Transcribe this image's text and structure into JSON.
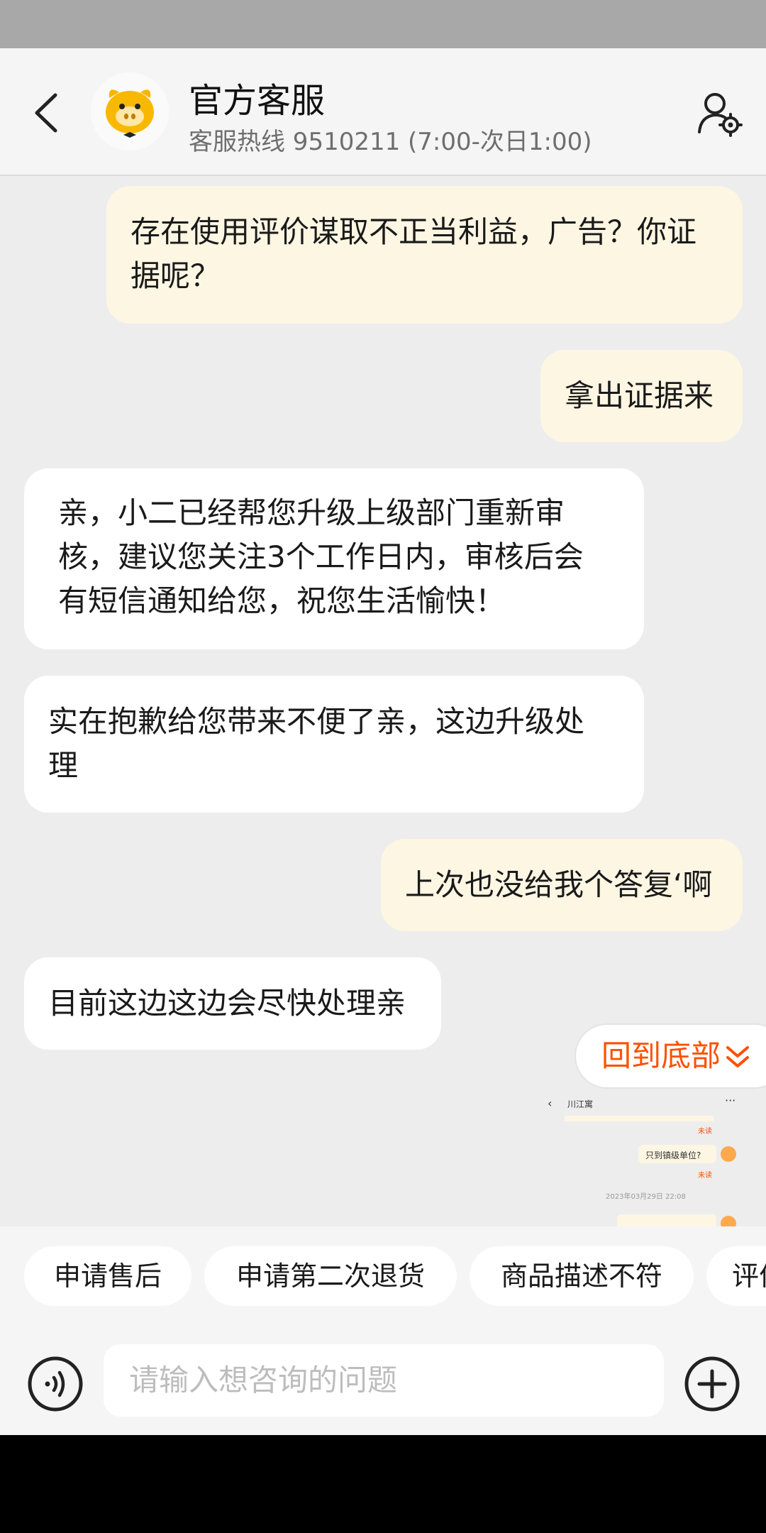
{
  "header": {
    "title": "官方客服",
    "subtitle": "客服热线 9510211 (7:00-次日1:00)"
  },
  "messages": [
    {
      "side": "out",
      "lines": [
        "存在使用评价谋取不正当利益，广告？你证",
        "据呢？"
      ]
    },
    {
      "side": "out",
      "lines": [
        "拿出证据来"
      ]
    },
    {
      "side": "in",
      "lines": [
        "亲，小二已经帮您升级上级部门重新审",
        "核，建议您关注3个工作日内，审核后会",
        "有短信通知给您，祝您生活愉快！"
      ]
    },
    {
      "side": "in",
      "lines": [
        "实在抱歉给您带来不便了亲，这边升级处",
        "理"
      ]
    },
    {
      "side": "out",
      "lines": [
        "上次也没给我个答复‘啊"
      ]
    },
    {
      "side": "in",
      "lines": [
        "目前这边这边会尽快处理亲"
      ]
    }
  ],
  "back_to_bottom": "回到底部",
  "thumbnail": {
    "title": "川江寓",
    "unread1": "未读",
    "msg": "只到镇级单位?",
    "unread2": "未读",
    "date": "2023年03月29日 22:08"
  },
  "quick_replies": [
    "申请售后",
    "申请第二次退货",
    "商品描述不符",
    "评价"
  ],
  "input": {
    "placeholder": "请输入想咨询的问题"
  },
  "colors": {
    "accent": "#ff5000",
    "outgoing_bubble": "#fdf6e3",
    "incoming_bubble": "#ffffff",
    "background": "#ededed"
  }
}
